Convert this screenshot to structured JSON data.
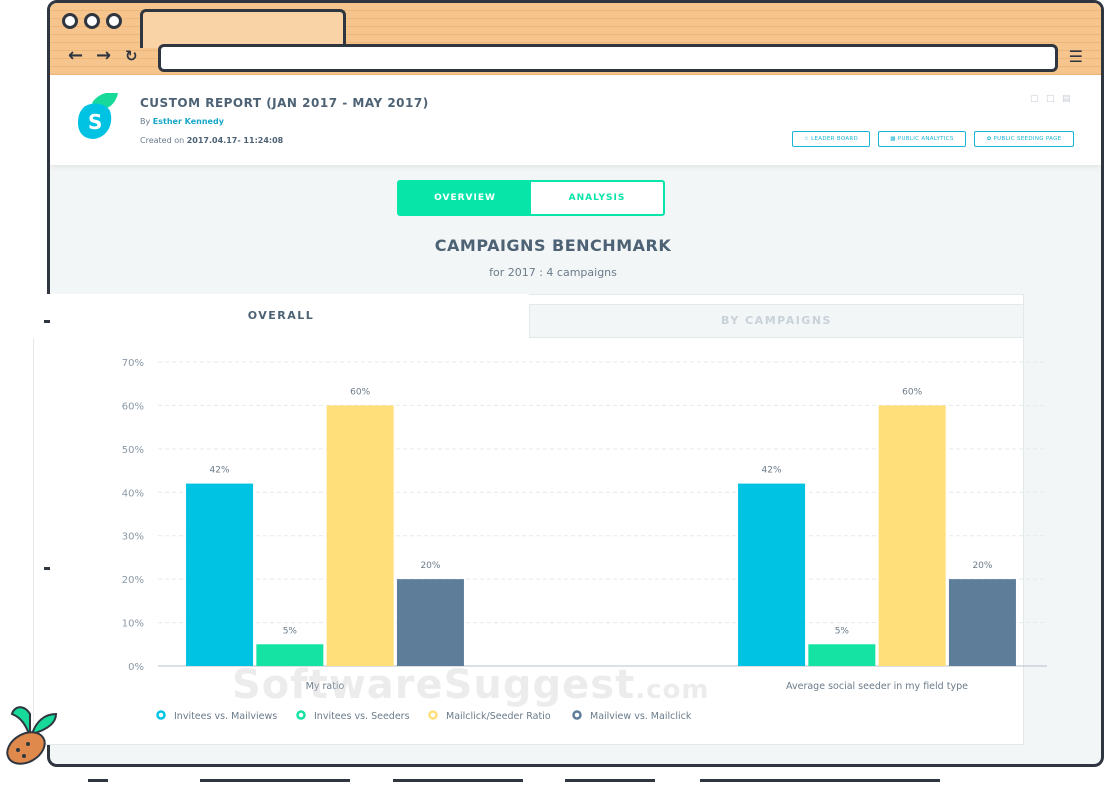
{
  "header": {
    "report_title": "CUSTOM REPORT (JAN 2017 - MAY 2017)",
    "by_label": "By",
    "author": "Esther Kennedy",
    "created_label": "Created on",
    "created_value": "2017.04.17- 11:24:08",
    "buttons": [
      "LEADER BOARD",
      "PUBLIC ANALYTICS",
      "PUBLIC SEEDING PAGE"
    ]
  },
  "toggle": {
    "overview": "OVERVIEW",
    "analysis": "ANALYSIS"
  },
  "benchmark": {
    "title": "CAMPAIGNS BENCHMARK",
    "subtitle": "for 2017 : 4 campaigns"
  },
  "tabs": {
    "overall": "OVERALL",
    "by_campaigns": "BY CAMPAIGNS"
  },
  "watermark": {
    "main": "SoftwareSuggest",
    "suffix": ".com"
  },
  "colors": {
    "accent": "#08e5a9",
    "blue": "#00c3e3",
    "green": "#14e3a3",
    "yellow": "#ffdf7a",
    "slate": "#5e7d99"
  },
  "chart_data": {
    "type": "bar",
    "categories": [
      "My ratio",
      "Average social seeder in my field type"
    ],
    "series": [
      {
        "name": "Invitees vs. Mailviews",
        "values": [
          42,
          42
        ],
        "color": "#00c3e3"
      },
      {
        "name": "Invitees vs. Seeders",
        "values": [
          5,
          5
        ],
        "color": "#14e3a3"
      },
      {
        "name": "Mailclick/Seeder Ratio",
        "values": [
          60,
          60
        ],
        "color": "#ffdf7a"
      },
      {
        "name": "Mailview vs. Mailclick",
        "values": [
          20,
          20
        ],
        "color": "#5e7d99"
      }
    ],
    "yticks": [
      "0%",
      "10%",
      "20%",
      "30%",
      "40%",
      "50%",
      "60%",
      "70%"
    ],
    "ylim": [
      0,
      70
    ],
    "data_labels": [
      "42%",
      "5%",
      "60%",
      "20%"
    ],
    "grid": true,
    "legend": "bottom-left"
  }
}
